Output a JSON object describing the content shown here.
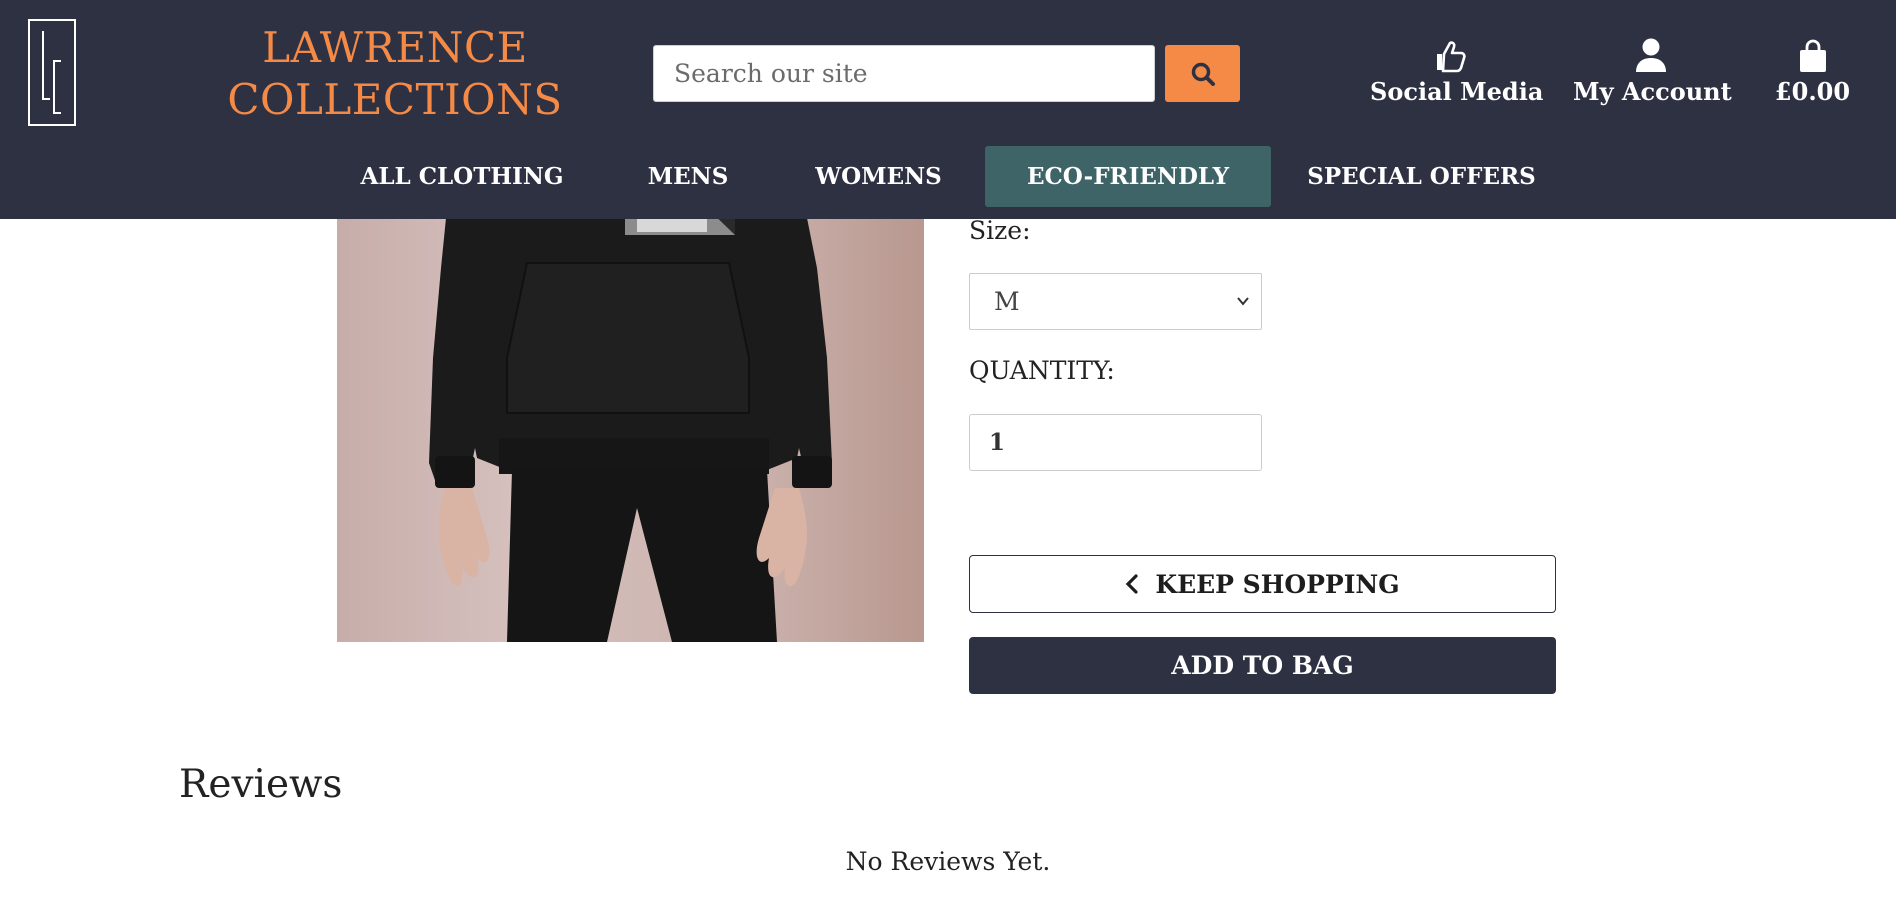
{
  "header": {
    "logo_letters": "LC",
    "brand_line1": "LAWRENCE",
    "brand_line2": "COLLECTIONS",
    "search_placeholder": "Search our site",
    "search_button_icon": "search-icon",
    "links": [
      {
        "icon": "thumbs-up-icon",
        "label": "Social Media"
      },
      {
        "icon": "user-icon",
        "label": "My Account"
      },
      {
        "icon": "shopping-bag-icon",
        "label": "£0.00"
      }
    ],
    "colors": {
      "background": "#2e3142",
      "brand": "#f58a47",
      "active_nav": "#3f6468"
    }
  },
  "nav": {
    "items": [
      {
        "label": "ALL CLOTHING"
      },
      {
        "label": "MENS"
      },
      {
        "label": "WOMENS"
      },
      {
        "label": "ECO-FRIENDLY",
        "active": true
      },
      {
        "label": "SPECIAL OFFERS"
      }
    ]
  },
  "product": {
    "size_label": "Size:",
    "size_value": "M",
    "quantity_label": "QUANTITY:",
    "quantity_value": "1",
    "keep_shopping_label": "KEEP SHOPPING",
    "add_to_bag_label": "ADD TO BAG"
  },
  "reviews": {
    "title": "Reviews",
    "empty_text": "No Reviews Yet."
  }
}
